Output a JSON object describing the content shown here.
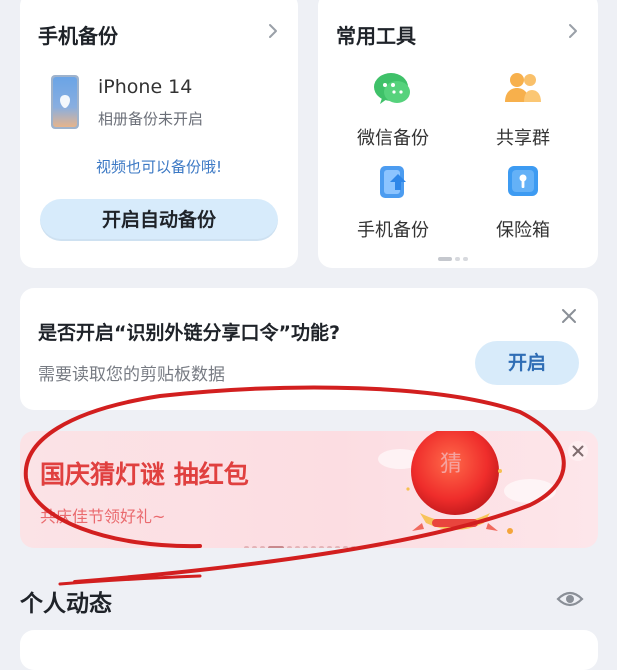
{
  "backup": {
    "title": "手机备份",
    "device_name": "iPhone 14",
    "device_status": "相册备份未开启",
    "hint": "视频也可以备份哦!",
    "button": "开启自动备份"
  },
  "tools": {
    "title": "常用工具",
    "items": [
      {
        "label": "微信备份",
        "icon": "wechat-icon"
      },
      {
        "label": "共享群",
        "icon": "group-icon"
      },
      {
        "label": "手机备份",
        "icon": "phone-backup-icon"
      },
      {
        "label": "保险箱",
        "icon": "safe-box-icon"
      }
    ]
  },
  "permission": {
    "title": "是否开启“识别外链分享口令”功能?",
    "subtitle": "需要读取您的剪贴板数据",
    "button": "开启"
  },
  "promo": {
    "title": "国庆猜灯谜 抽红包",
    "subtitle": "共庆佳节领好礼~",
    "lantern_char": "猜"
  },
  "section": {
    "title": "个人动态"
  },
  "colors": {
    "accent_blue": "#3b78c4",
    "promo_red": "#e0403f",
    "annotation_red": "#d21f1f"
  }
}
